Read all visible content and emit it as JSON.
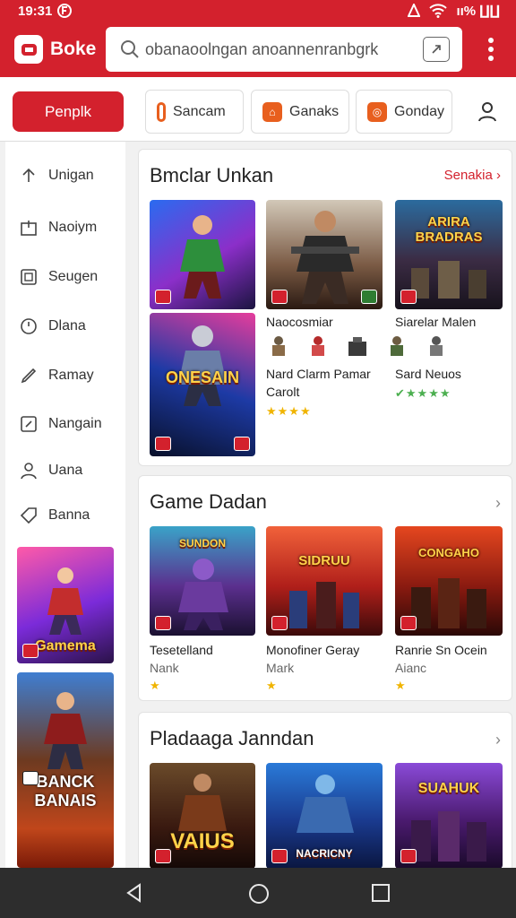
{
  "status_bar": {
    "time": "19:31",
    "time_icon": "circle-f",
    "right": "ıı%  ∐∐"
  },
  "header": {
    "app_name": "Boke",
    "search_text": "obanaoolngan  anoannenranbgrk",
    "search_icon": "search-icon",
    "menu_icon": "more-vertical-icon",
    "accent": "#d3212d"
  },
  "tabs": {
    "primary": "Penplk",
    "items": [
      "Sancam",
      "Ganaks",
      "Gonday"
    ],
    "user_icon": "user-icon"
  },
  "sidebar": {
    "items": [
      {
        "label": "Unigan",
        "icon": "upload-icon"
      },
      {
        "label": "Naoiym",
        "icon": "bookmark-box-icon"
      },
      {
        "label": "Seugen",
        "icon": "image-box-icon"
      },
      {
        "label": "Dlana",
        "icon": "clock-icon"
      },
      {
        "label": "Ramay",
        "icon": "pen-icon"
      },
      {
        "label": "Nangain",
        "icon": "edit-box-icon"
      },
      {
        "label": "Uana",
        "icon": "person-icon"
      },
      {
        "label": "Banna",
        "icon": "tag-icon"
      }
    ],
    "posters": [
      "Gamema",
      "BANCK BANAIS"
    ]
  },
  "sections": [
    {
      "title": "Bmclar Unkan",
      "link": "Senakia",
      "tall_posters": [
        "",
        "ONESAIN"
      ],
      "games": [
        {
          "name": "Naocosmiar",
          "lines": [
            "Nard Clarm Pamar",
            "Carolt"
          ],
          "stars": "★★★★",
          "poster": ""
        },
        {
          "name": "Siarelar Malen",
          "lines": [
            "Sard Neuos"
          ],
          "stars": "✔★★★★",
          "poster": "ARIRA BRADRAS"
        }
      ]
    },
    {
      "title": "Game Dadan",
      "games": [
        {
          "name": "Tesetelland",
          "sub": "Nank",
          "stars": "★",
          "poster": "SUNDON"
        },
        {
          "name": "Monofiner Geray",
          "sub": "Mark",
          "stars": "★",
          "poster": "SIDRUU"
        },
        {
          "name": "Ranrie Sn Ocein",
          "sub": "Aianc",
          "stars": "★",
          "poster": "CONGAHO"
        }
      ]
    },
    {
      "title": "Pladaaga Janndan",
      "games": [
        {
          "poster": "VAIUS"
        },
        {
          "poster": "NACRICNY"
        },
        {
          "poster": "SUAHUK"
        }
      ]
    }
  ],
  "nav": {
    "back_icon": "back-triangle-icon",
    "home_icon": "home-circle-icon",
    "recents_icon": "recents-square-icon"
  }
}
